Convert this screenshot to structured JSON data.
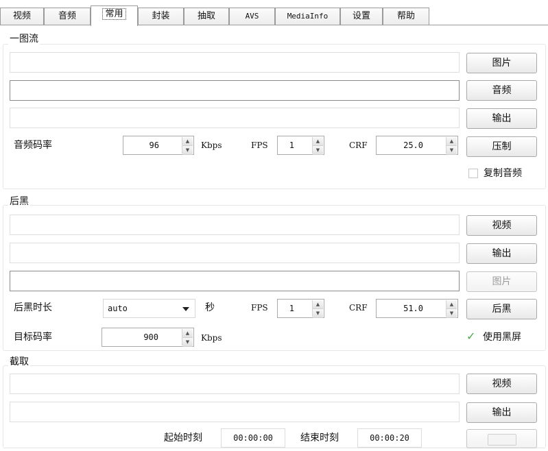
{
  "tabs": [
    {
      "label": "视频"
    },
    {
      "label": "音频"
    },
    {
      "label": "常用"
    },
    {
      "label": "封装"
    },
    {
      "label": "抽取"
    },
    {
      "label": "AVS"
    },
    {
      "label": "MediaInfo"
    },
    {
      "label": "设置"
    },
    {
      "label": "帮助"
    }
  ],
  "active_tab": "常用",
  "one_image_stream": {
    "title": "一图流",
    "image_path": "",
    "audio_path": "",
    "output_path": "",
    "buttons": {
      "image": "图片",
      "audio": "音频",
      "output": "输出",
      "encode": "压制"
    },
    "audio_bitrate_label": "音频码率",
    "audio_bitrate": "96",
    "kbps_label": "Kbps",
    "fps_label": "FPS",
    "fps": "1",
    "crf_label": "CRF",
    "crf": "25.0",
    "copy_audio_label": "复制音频",
    "copy_audio_checked": false
  },
  "post_black": {
    "title": "后黑",
    "video_path": "",
    "output_path": "",
    "image_path": "",
    "buttons": {
      "video": "视频",
      "output": "输出",
      "image": "图片",
      "post_black": "后黑"
    },
    "duration_label": "后黑时长",
    "duration": "auto",
    "seconds_label": "秒",
    "fps_label": "FPS",
    "fps": "1",
    "crf_label": "CRF",
    "crf": "51.0",
    "target_bitrate_label": "目标码率",
    "target_bitrate": "900",
    "kbps_label": "Kbps",
    "use_black_screen_label": "使用黑屏",
    "use_black_screen_checked": true
  },
  "clip": {
    "title": "截取",
    "video_path": "",
    "output_path": "",
    "buttons": {
      "video": "视频",
      "output": "输出"
    },
    "start_label": "起始时刻",
    "start_time": "00:00:00",
    "end_label": "结束时刻",
    "end_time": "00:00:20"
  },
  "colors": {
    "check": "#4aa84a",
    "border": "#a8a8a8"
  }
}
